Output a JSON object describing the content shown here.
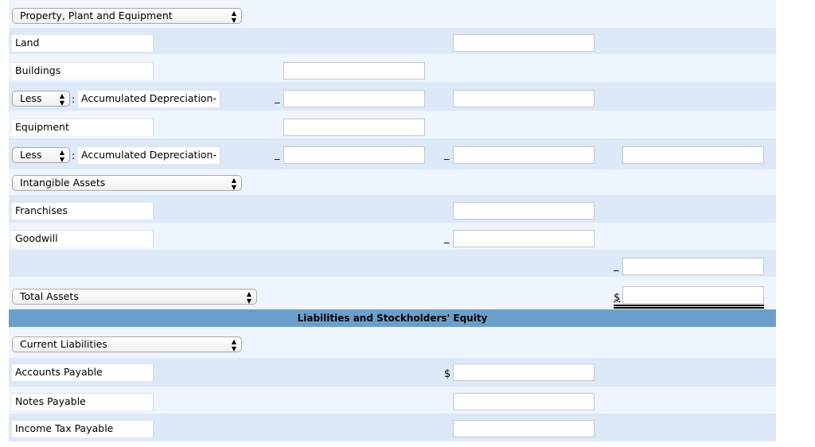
{
  "assets": {
    "ppe_select": "Property, Plant and Equipment",
    "land": "Land",
    "buildings": "Buildings",
    "less1": "Less",
    "acc_dep1": "Accumulated Depreciation-",
    "equipment": "Equipment",
    "less2": "Less",
    "acc_dep2": "Accumulated Depreciation-",
    "intangible_select": "Intangible Assets",
    "franchises": "Franchises",
    "goodwill": "Goodwill",
    "total_select": "Total Assets",
    "dollar": "$",
    "underscore": "_"
  },
  "liabilities": {
    "header": "Liabilities and Stockholders' Equity",
    "current_select": "Current Liabilities",
    "accounts_payable": "Accounts Payable",
    "notes_payable": "Notes Payable",
    "income_tax_payable": "Income Tax Payable",
    "dollar": "$"
  },
  "colors": {
    "row_light": "#eef5fe",
    "row_dark": "#dde9f8",
    "header": "#6a9fcc"
  }
}
